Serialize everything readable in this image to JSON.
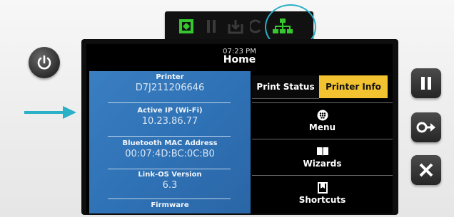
{
  "screen": {
    "time": "07:23 PM",
    "title": "Home"
  },
  "printer_info": [
    {
      "label": "Printer",
      "value": "D7J211206646"
    },
    {
      "label": "Active IP (Wi-Fi)",
      "value": "10.23.86.77"
    },
    {
      "label": "Bluetooth MAC Address",
      "value": "00:07:4D:BC:0C:B0"
    },
    {
      "label": "Link-OS Version",
      "value": "6.3"
    },
    {
      "label": "Firmware",
      "value": ""
    }
  ],
  "tabs": {
    "status_label": "Print Status",
    "info_label": "Printer Info",
    "active_tab": "Printer Info"
  },
  "menu": [
    {
      "label": "Menu",
      "icon": "menu-grid-icon"
    },
    {
      "label": "Wizards",
      "icon": "book-icon"
    },
    {
      "label": "Shortcuts",
      "icon": "bookmark-icon"
    }
  ],
  "status_leds": [
    "status-icon",
    "pause-icon",
    "data-icon",
    "supplies-icon",
    "network-icon"
  ],
  "colors": {
    "info_panel_blue": "#2f72b6",
    "active_tab_yellow": "#f2c230",
    "led_green": "#35c72d",
    "highlight_cyan": "#2ab0c7"
  }
}
